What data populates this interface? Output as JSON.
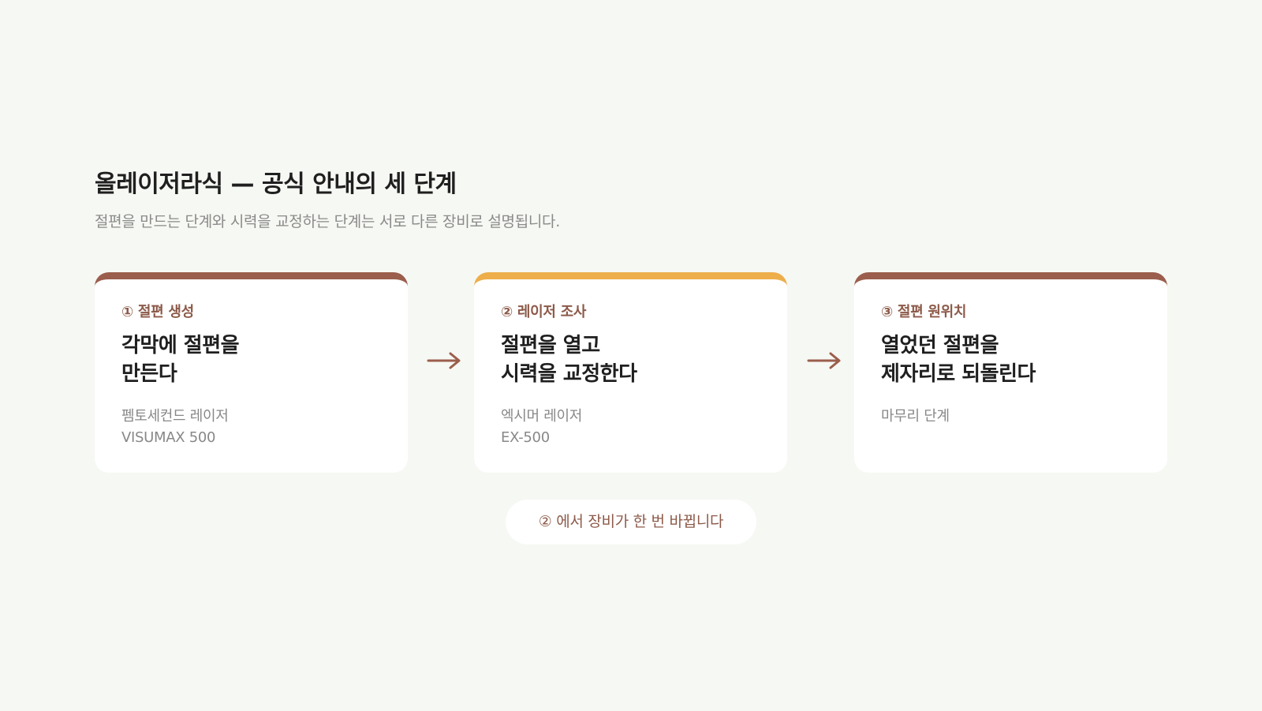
{
  "header": {
    "title": "올레이저라식 — 공식 안내의 세 단계",
    "subtitle": "절편을 만드는 단계와 시력을 교정하는 단계는 서로 다른 장비로 설명됩니다."
  },
  "steps": [
    {
      "label": "① 절편 생성",
      "title": "각막에 절편을\n만든다",
      "desc": "펨토세컨드 레이저\nVISUMAX 500"
    },
    {
      "label": "② 레이저 조사",
      "title": "절편을 열고\n시력을 교정한다",
      "desc": "엑시머 레이저\nEX-500"
    },
    {
      "label": "③ 절편 원위치",
      "title": "열었던 절편을\n제자리로 되돌린다",
      "desc": "마무리 단계"
    }
  ],
  "note": {
    "text": "② 에서 장비가 한 번 바뀝니다"
  },
  "colors": {
    "background": "#f6f8f3",
    "accent_brown": "#9b5e4c",
    "accent_amber": "#edae4b",
    "label_brown": "#8c5a49"
  },
  "icons": {
    "between_steps": "arrow-right-icon"
  }
}
